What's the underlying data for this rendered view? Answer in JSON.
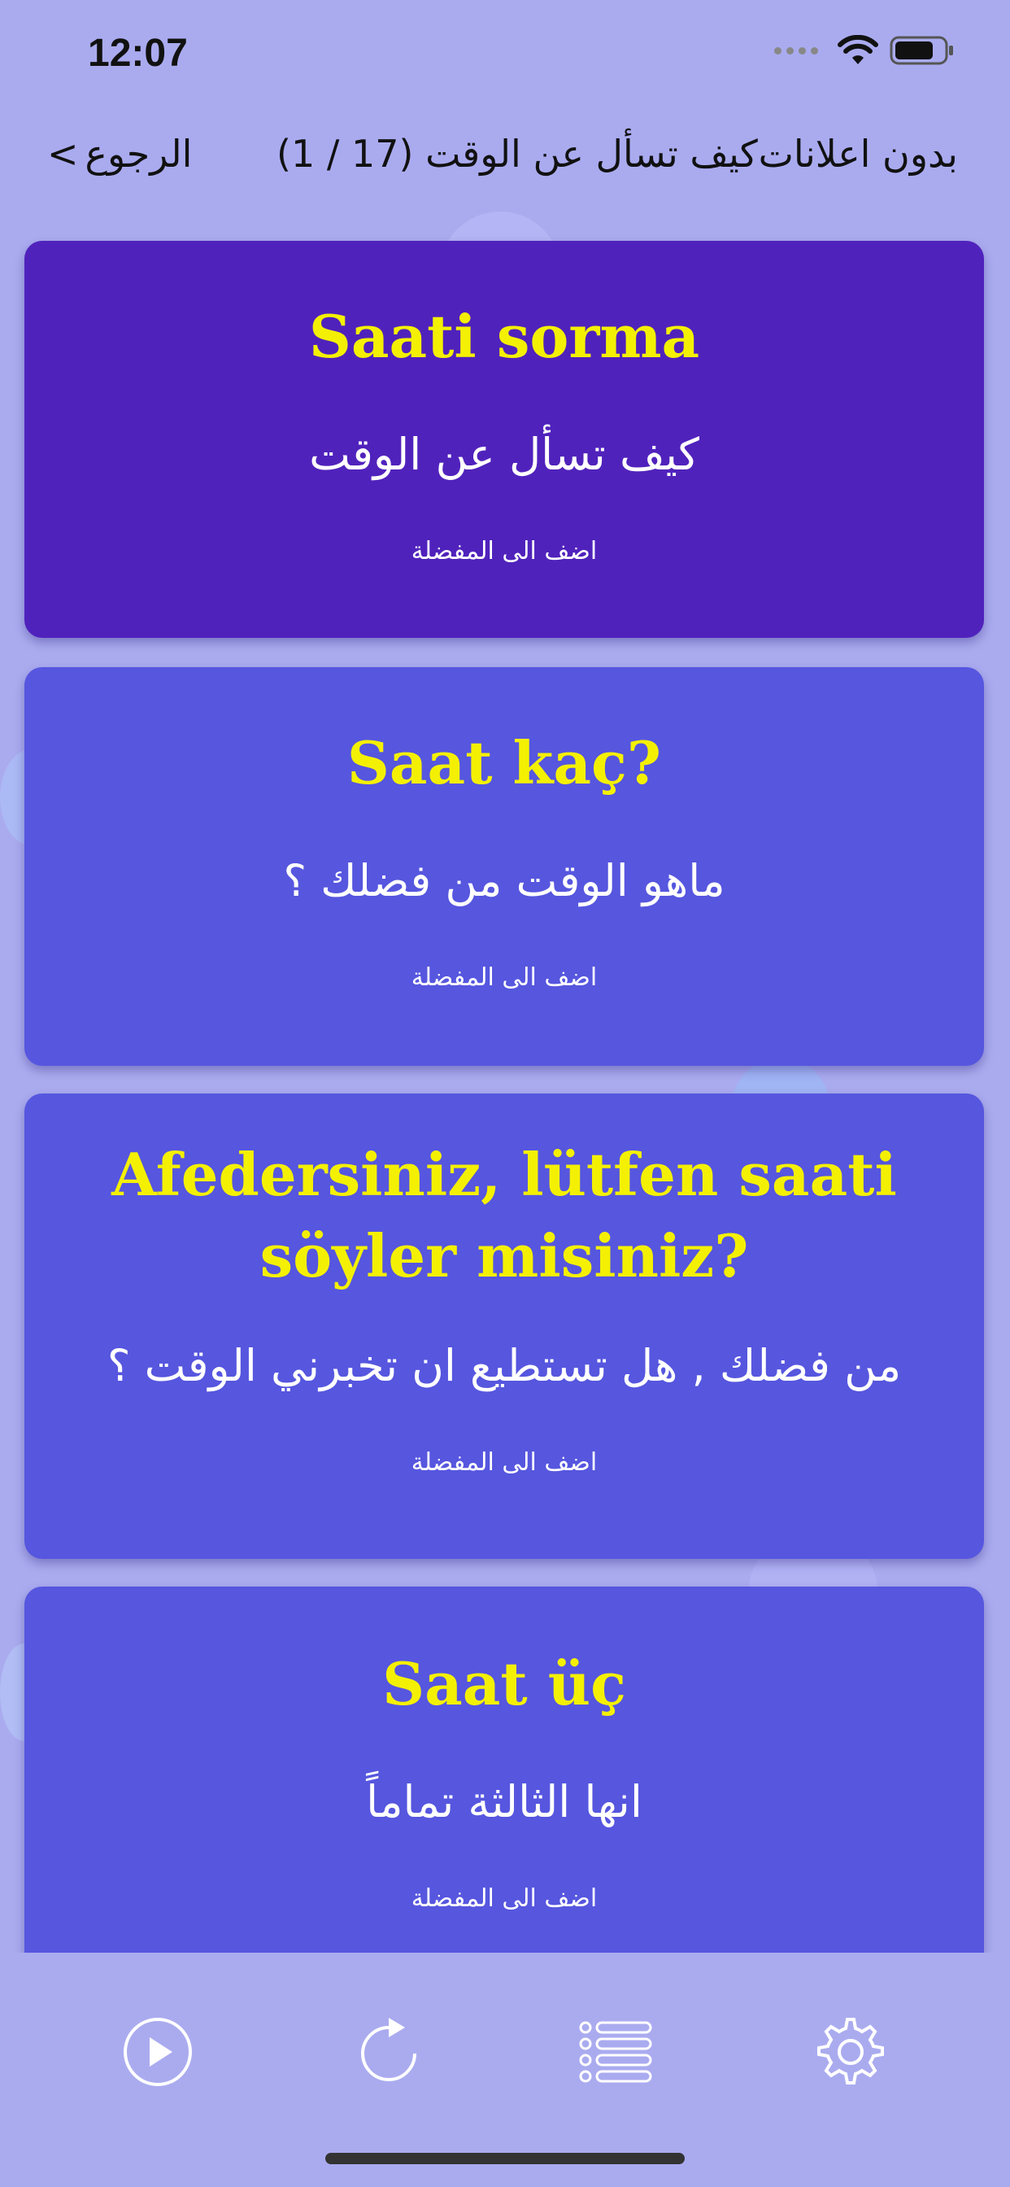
{
  "status_bar": {
    "time": "12:07"
  },
  "nav": {
    "back_label": "الرجوع",
    "back_icon": "chevron-left-icon",
    "title": "كيف تسأل عن الوقت",
    "counter": "(17 / 1)",
    "no_ads_label": "بدون اعلانات"
  },
  "cards": [
    {
      "title": "Saati sorma",
      "translation": "كيف تسأل عن الوقت",
      "favorite_label": "اضف الى المفضلة",
      "active": true
    },
    {
      "title": "Saat kaç?",
      "translation": "ماهو الوقت من فضلك ؟",
      "favorite_label": "اضف الى المفضلة",
      "active": false
    },
    {
      "title_line1": "Afedersiniz, lütfen saati",
      "title_line2": "söyler misiniz?",
      "translation": "من فضلك , هل تستطيع ان تخبرني الوقت ؟",
      "favorite_label": "اضف الى المفضلة",
      "active": false
    },
    {
      "title": "Saat üç",
      "translation": "انها الثالثة تماماً",
      "favorite_label": "اضف الى المفضلة",
      "active": false
    }
  ],
  "toolbar": {
    "items": [
      {
        "icon": "play-icon"
      },
      {
        "icon": "replay-icon"
      },
      {
        "icon": "list-icon"
      },
      {
        "icon": "gear-icon"
      }
    ]
  },
  "colors": {
    "background": "#aaabef",
    "card_active": "#5022bc",
    "card_normal": "#5656df",
    "title_yellow": "#f4f003",
    "text_white": "#ffffff"
  }
}
